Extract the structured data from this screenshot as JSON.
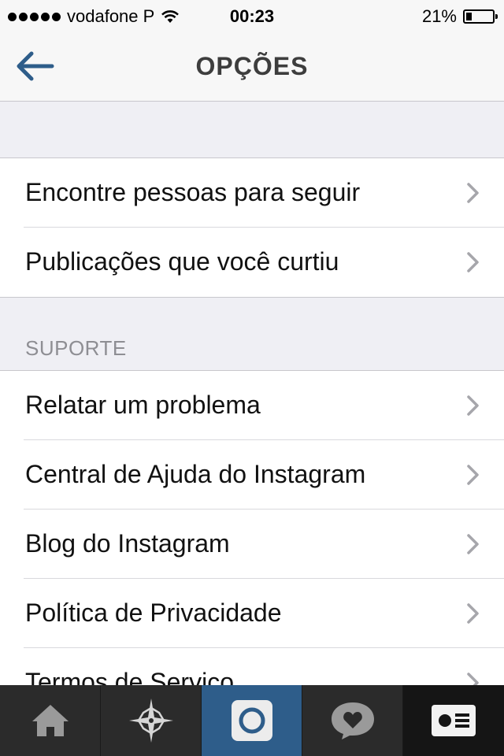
{
  "status_bar": {
    "carrier": "vodafone P",
    "time": "00:23",
    "battery": "21%"
  },
  "nav": {
    "title": "OPÇÕES",
    "back_icon": "back-arrow-icon"
  },
  "colors": {
    "accent": "#2e5d8a",
    "background": "#efeff4",
    "tab_bar": "#2b2b2b"
  },
  "group1": {
    "items": [
      {
        "label": "Encontre pessoas para seguir"
      },
      {
        "label": "Publicações que você curtiu"
      }
    ]
  },
  "support": {
    "header": "SUPORTE",
    "items": [
      {
        "label": "Relatar um problema"
      },
      {
        "label": "Central de Ajuda do Instagram"
      },
      {
        "label": "Blog do Instagram"
      },
      {
        "label": "Política de Privacidade"
      },
      {
        "label": "Termos de Serviço"
      }
    ]
  },
  "tab_bar": {
    "tabs": [
      {
        "icon": "home-icon"
      },
      {
        "icon": "explore-star-icon"
      },
      {
        "icon": "camera-icon"
      },
      {
        "icon": "activity-heart-icon"
      },
      {
        "icon": "profile-card-icon"
      }
    ]
  }
}
